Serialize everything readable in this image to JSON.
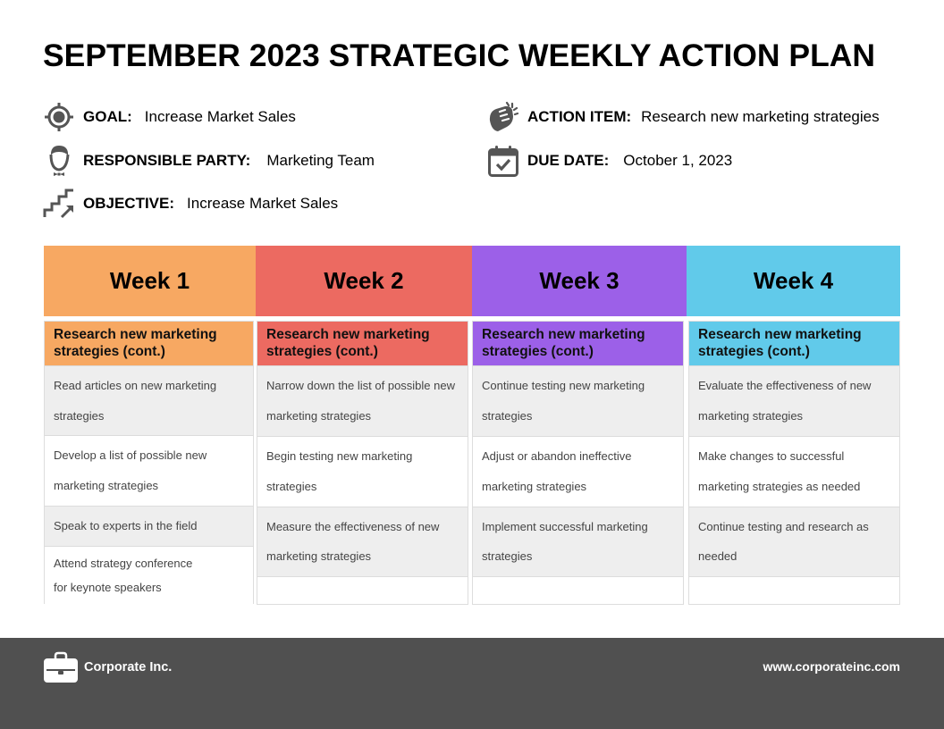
{
  "title": "SEPTEMBER 2023 STRATEGIC WEEKLY ACTION PLAN",
  "info": {
    "goal": {
      "icon": "target-icon",
      "label": "GOAL:",
      "value": "Increase Market Sales"
    },
    "responsible": {
      "icon": "person-icon",
      "label": "RESPONSIBLE PARTY:",
      "value": "Marketing Team"
    },
    "objective": {
      "icon": "stairs-arrow-icon",
      "label": "OBJECTIVE:",
      "value": "Increase Market Sales"
    },
    "action": {
      "icon": "fist-icon",
      "label": "ACTION ITEM:",
      "value": "Research new marketing strategies"
    },
    "due": {
      "icon": "calendar-check-icon",
      "label": "DUE DATE:",
      "value": "October 1, 2023"
    }
  },
  "colors": {
    "week1": "#F7A862",
    "week2": "#EC6A61",
    "week3": "#9C60E8",
    "week4": "#61CAEA",
    "icon": "#555555",
    "footer": "#505050"
  },
  "weeks": [
    {
      "label": "Week 1",
      "subheading_lines": [
        "Research new marketing",
        "strategies (cont.)"
      ],
      "tasks": [
        {
          "lines": [
            "Read articles on new marketing",
            "strategies"
          ]
        },
        {
          "lines": [
            "Develop a list of possible new",
            "marketing strategies"
          ]
        },
        {
          "lines": [
            "Speak to experts in the field"
          ]
        },
        {
          "lines": [
            "Attend strategy conference",
            "for keynote speakers"
          ]
        }
      ]
    },
    {
      "label": "Week 2",
      "subheading_lines": [
        "Research new marketing",
        "strategies (cont.)"
      ],
      "tasks": [
        {
          "lines": [
            "Narrow down the list of possible new",
            "marketing strategies"
          ]
        },
        {
          "lines": [
            "Begin testing new marketing",
            "strategies"
          ]
        },
        {
          "lines": [
            "Measure the effectiveness of new",
            "marketing strategies"
          ]
        },
        {
          "lines": []
        }
      ]
    },
    {
      "label": "Week 3",
      "subheading_lines": [
        "Research new marketing",
        "strategies (cont.)"
      ],
      "tasks": [
        {
          "lines": [
            "Continue testing new marketing",
            "strategies"
          ]
        },
        {
          "lines": [
            "Adjust or abandon ineffective",
            "marketing strategies"
          ]
        },
        {
          "lines": [
            "Implement successful marketing",
            "strategies"
          ]
        },
        {
          "lines": []
        }
      ]
    },
    {
      "label": "Week 4",
      "subheading_lines": [
        "Research new marketing",
        "strategies (cont.)"
      ],
      "tasks": [
        {
          "lines": [
            "Evaluate the effectiveness of new",
            "marketing strategies"
          ]
        },
        {
          "lines": [
            "Make changes to successful",
            "marketing strategies as needed"
          ]
        },
        {
          "lines": [
            "Continue testing and research as",
            "needed"
          ]
        },
        {
          "lines": []
        }
      ]
    }
  ],
  "footer": {
    "company_icon": "briefcase-icon",
    "company": "Corporate Inc.",
    "url": "www.corporateinc.com"
  }
}
